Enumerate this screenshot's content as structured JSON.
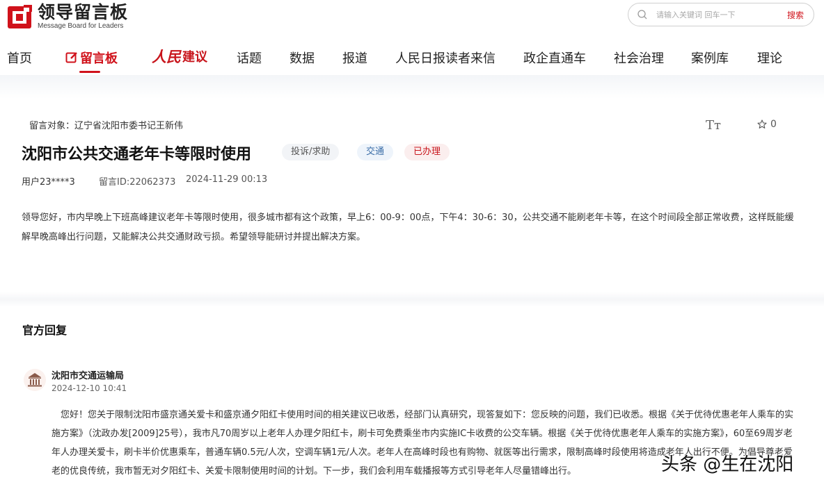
{
  "header": {
    "logo_title": "领导留言板",
    "logo_subtitle": "Message Board for Leaders",
    "search_placeholder": "请输入关键词 回车一下",
    "search_button": "搜索"
  },
  "nav": {
    "items": [
      "首页",
      "留言板",
      "人民",
      "建议",
      "话题",
      "数据",
      "报道",
      "人民日报读者来信",
      "政企直通车",
      "社会治理",
      "案例库",
      "理论"
    ],
    "active_index": 1
  },
  "message": {
    "target_label": "留言对象：辽宁省沈阳市委书记王新伟",
    "font_size_label": "Tт",
    "favorite_count": "0",
    "title": "沈阳市公共交通老年卡等限时使用",
    "tags": [
      "投诉/求助",
      "交通",
      "已办理"
    ],
    "user": "用户23****3",
    "message_id": "留言ID:22062373",
    "time": "2024-11-29 00:13",
    "body": "领导您好，市内早晚上下班高峰建议老年卡等限时使用，很多城市都有这个政策，早上6：00-9：00点，下午4：30-6：30，公共交通不能刷老年卡等，在这个时间段全部正常收费，这样既能缓解早晚高峰出行问题，又能解决公共交通财政亏损。希望领导能研讨并提出解决方案。"
  },
  "reply": {
    "heading": "官方回复",
    "department": "沈阳市交通运输局",
    "time": "2024-12-10 10:41",
    "text": "您好！您关于限制沈阳市盛京通关爱卡和盛京通夕阳红卡使用时间的相关建议已收悉，经部门认真研究，现答复如下：您反映的问题，我们已收悉。根据《关于优待优惠老年人乘车的实施方案》（沈政办发[2009]25号），我市凡70周岁以上老年人办理夕阳红卡，刷卡可免费乘坐市内实施IC卡收费的公交车辆。根据《关于优待优惠老年人乘车的实施方案》，60至69周岁老年人办理关爱卡，刷卡半价优惠乘车，普通车辆0.5元/人次，空调车辆1元/人次。老年人在高峰时段也有购物、就医等出行需求，限制高峰时段使用将造成老年人出行不便。为倡导尊老爱老的优良传统，我市暂无对夕阳红卡、关爱卡限制使用时间的计划。下一步，我们会利用车载播报等方式引导老年人尽量错峰出行。"
  },
  "watermark": "头条 @生在沈阳",
  "colors": {
    "brand_red": "#d0121b"
  }
}
